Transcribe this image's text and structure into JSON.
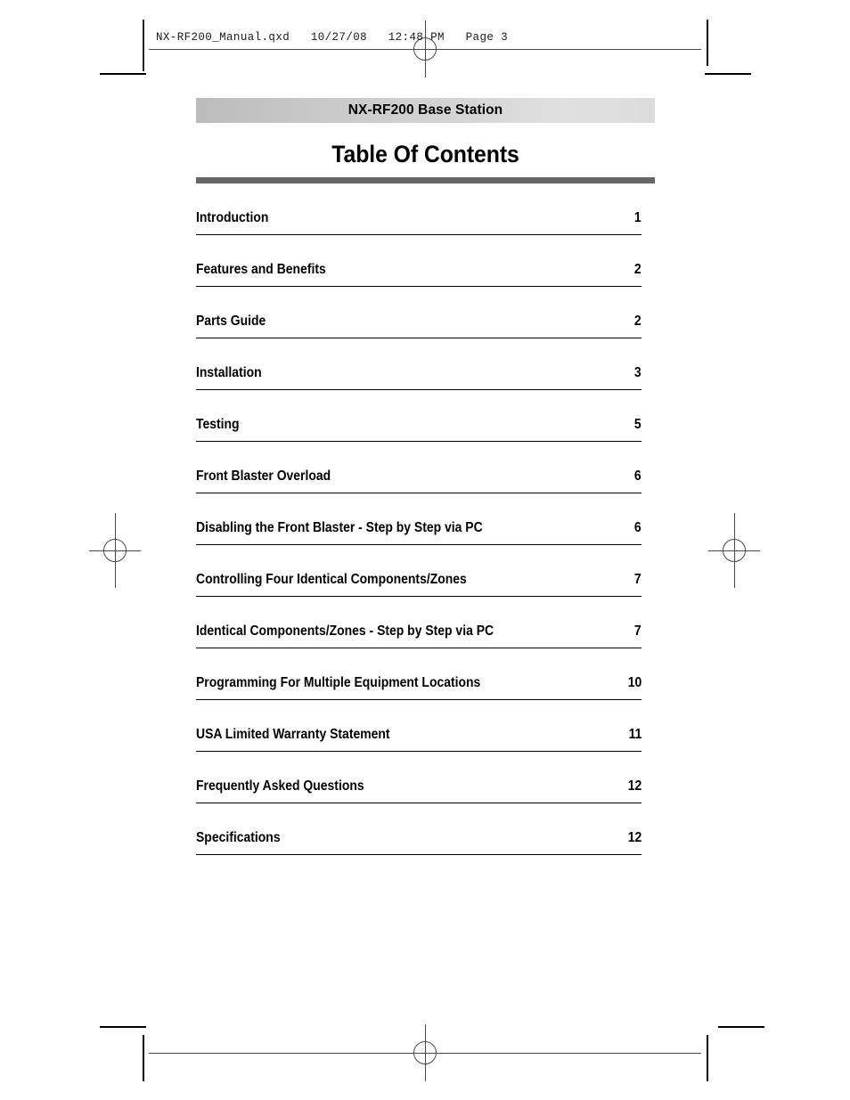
{
  "file_stamp": {
    "text": "NX-RF200_Manual.qxd   10/27/08   12:48 PM   Page 3"
  },
  "product_bar": {
    "title": "NX-RF200 Base Station",
    "gradient_from": "#bcbcbc",
    "gradient_to": "#dcdcdc"
  },
  "page_heading": {
    "title": "Table Of Contents",
    "rule_color": "#666666"
  },
  "toc": {
    "entries": [
      {
        "label": "Introduction",
        "page": "1"
      },
      {
        "label": "Features and Benefits",
        "page": "2"
      },
      {
        "label": "Parts Guide",
        "page": "2"
      },
      {
        "label": "Installation",
        "page": "3"
      },
      {
        "label": "Testing",
        "page": "5"
      },
      {
        "label": "Front Blaster Overload",
        "page": "6"
      },
      {
        "label": "Disabling the Front Blaster - Step by Step via PC",
        "page": "6"
      },
      {
        "label": "Controlling Four Identical Components/Zones",
        "page": "7"
      },
      {
        "label": "Identical Components/Zones - Step by Step via PC",
        "page": "7"
      },
      {
        "label": "Programming For Multiple Equipment Locations",
        "page": "10"
      },
      {
        "label": "USA Limited Warranty Statement",
        "page": "11"
      },
      {
        "label": "Frequently Asked Questions",
        "page": "12"
      },
      {
        "label": "Specifications",
        "page": "12"
      }
    ]
  },
  "prepress_marks": {
    "crop_mark_color": "#000000",
    "registration_color": "#4a4a4a"
  }
}
